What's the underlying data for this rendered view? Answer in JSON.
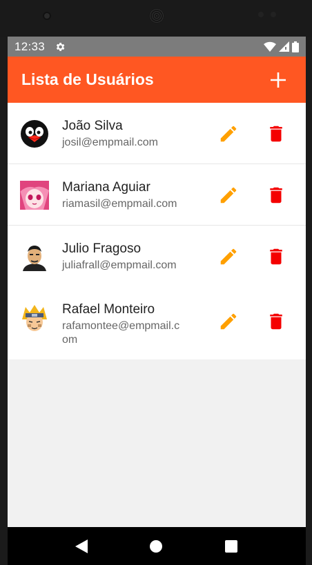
{
  "status_bar": {
    "time": "12:33"
  },
  "app_bar": {
    "title": "Lista de Usuários",
    "add_icon": "plus-icon"
  },
  "theme": {
    "primary": "#ff5722",
    "edit_color": "#ffa000",
    "delete_color": "#f40000"
  },
  "users": [
    {
      "name": "João Silva",
      "email": "josil@empmail.com",
      "avatar": "penguin-avatar"
    },
    {
      "name": "Mariana Aguiar",
      "email": "riamasil@empmail.com",
      "avatar": "anime-girl-avatar"
    },
    {
      "name": "Julio Fragoso",
      "email": "juliafrall@empmail.com",
      "avatar": "man-avatar"
    },
    {
      "name": "Rafael Monteiro",
      "email": "rafamontee@empmail.com",
      "avatar": "naruto-avatar"
    }
  ]
}
